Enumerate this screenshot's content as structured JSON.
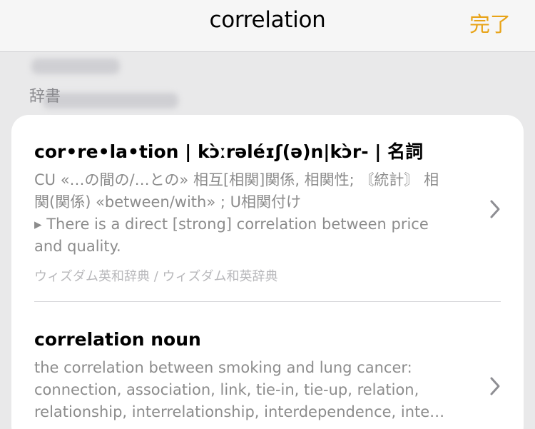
{
  "nav": {
    "title": "correlation",
    "done_label": "完了"
  },
  "section": {
    "label": "辞書"
  },
  "entries": [
    {
      "headword": "cor•re•la•tion | kɔ̀ːrəléɪʃ(ə)n|kɔ̀r- | 名詞",
      "lines": [
        "CU «…の間の/…との» 相互[相関]関係, 相関性; 〘統計〙 相",
        "関(関係) «between/with» ; U相関付け",
        "▸ There is a direct [strong] correlation between price",
        "and quality."
      ],
      "source": "ウィズダム英和辞典 / ウィズダム和英辞典"
    },
    {
      "headword": "correlation noun",
      "lines": [
        "the correlation between smoking and lung cancer:",
        "connection, association, link, tie-in, tie-up, relation,",
        "relationship, interrelationship, interdependence, inte…"
      ]
    }
  ],
  "colors": {
    "accent": "#e8a317",
    "secondary_text": "#8c8c8c",
    "tertiary_text": "#b8b8bb",
    "background": "#e9e9ea",
    "card": "#ffffff"
  },
  "icons": {
    "row_chevron": "chevron-right-icon"
  }
}
